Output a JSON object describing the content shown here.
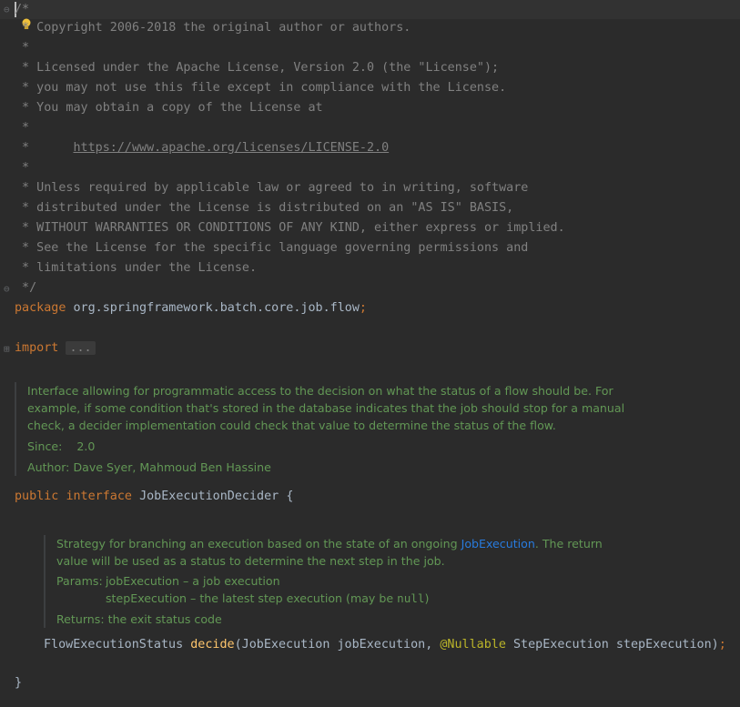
{
  "license_comment": {
    "open": "/*",
    "lines": [
      " * Copyright 2006-2018 the original author or authors.",
      " *",
      " * Licensed under the Apache License, Version 2.0 (the \"License\");",
      " * you may not use this file except in compliance with the License.",
      " * You may obtain a copy of the License at",
      " *",
      " *      ",
      " *",
      " * Unless required by applicable law or agreed to in writing, software",
      " * distributed under the License is distributed on an \"AS IS\" BASIS,",
      " * WITHOUT WARRANTIES OR CONDITIONS OF ANY KIND, either express or implied.",
      " * See the License for the specific language governing permissions and",
      " * limitations under the License.",
      " */"
    ],
    "url": "https://www.apache.org/licenses/LICENSE-2.0"
  },
  "package_line": {
    "keyword": "package",
    "name": " org.springframework.batch.core.job.flow",
    "semicolon": ";"
  },
  "import_line": {
    "keyword": "import",
    "folded": "..."
  },
  "class_doc": {
    "description": "Interface allowing for programmatic access to the decision on what the status of a flow should be. For example, if some condition that's stored in the database indicates that the job should stop for a manual check, a decider implementation could check that value to determine the status of the flow.",
    "since_label": "Since:",
    "since_value": "2.0",
    "author_label": "Author:",
    "author_value": "Dave Syer, Mahmoud Ben Hassine"
  },
  "interface_decl": {
    "kw_public": "public",
    "kw_interface": "interface",
    "name": "JobExecutionDecider",
    "brace": "{"
  },
  "method_doc": {
    "text_before": "Strategy for branching an execution based on the state of an ongoing ",
    "ref": "JobExecution",
    "text_after": ". The return value will be used as a status to determine the next step in the job.",
    "params_label": "Params:",
    "param1": "jobExecution – a job execution",
    "param2_before": "stepExecution – the latest step execution (may be ",
    "param2_null": "null",
    "param2_after": ")",
    "returns_label": "Returns:",
    "returns_value": "the exit status code"
  },
  "method_decl": {
    "return_type": "FlowExecutionStatus ",
    "name": "decide",
    "params_a": "(JobExecution jobExecution, ",
    "annotation": "@Nullable",
    "params_b": " StepExecution stepExecution)",
    "semicolon": ";"
  },
  "closing_brace": "}"
}
